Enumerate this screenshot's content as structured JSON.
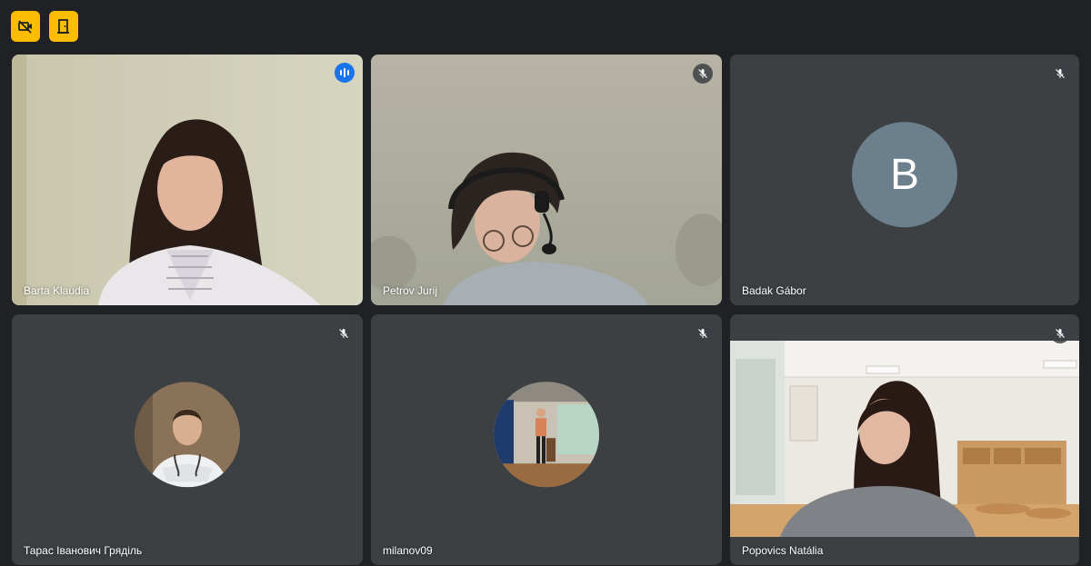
{
  "toolbar": {
    "buttons": [
      {
        "icon": "camera-off-icon",
        "color": "#fbbc04"
      },
      {
        "icon": "exit-door-icon",
        "color": "#fbbc04"
      }
    ]
  },
  "participants": [
    {
      "name": "Barta Klaudia",
      "status": "speaking",
      "kind": "video"
    },
    {
      "name": "Petrov Jurij",
      "status": "muted",
      "kind": "video"
    },
    {
      "name": "Badak Gábor",
      "status": "muted",
      "kind": "initial",
      "initial": "B"
    },
    {
      "name": "Тарас Іванович Гряділь",
      "status": "muted",
      "kind": "photo"
    },
    {
      "name": "milanov09",
      "status": "muted",
      "kind": "photo"
    },
    {
      "name": "Popovics Natália",
      "status": "muted",
      "kind": "video"
    }
  ],
  "colors": {
    "background": "#202124",
    "tile": "#3c4043",
    "active_border": "#8ab4f8",
    "speaking_badge": "#1a73e8",
    "toolbar_button": "#fbbc04",
    "avatar_b": "#6b7f8d"
  }
}
